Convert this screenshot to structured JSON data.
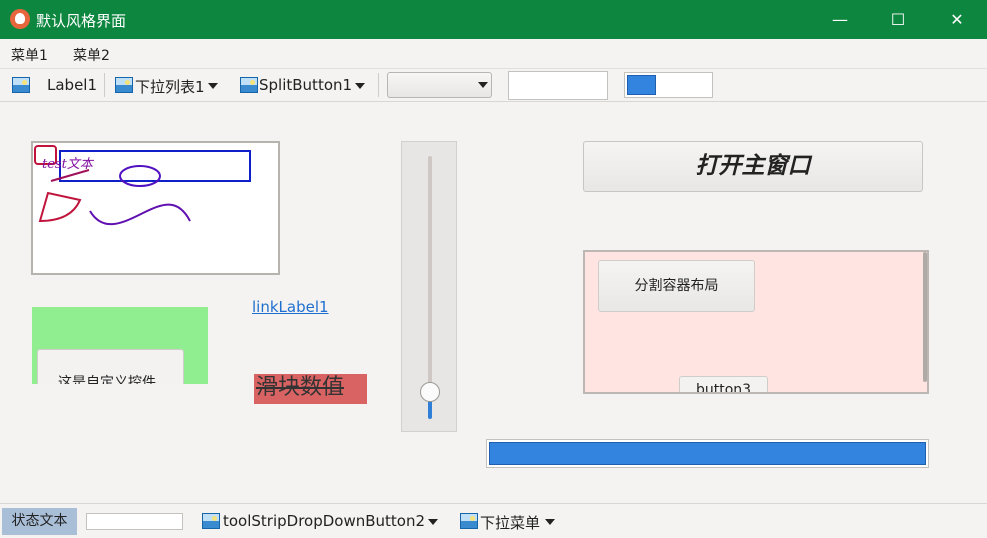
{
  "window": {
    "title": "默认风格界面",
    "controls": {
      "minimize": "—",
      "maximize": "☐",
      "close": "✕"
    }
  },
  "menu": {
    "items": [
      "菜单1",
      "菜单2"
    ]
  },
  "toolbar": {
    "label1": "Label1",
    "dropdown1": "下拉列表1",
    "split_button1": "SplitButton1",
    "combo_value": "",
    "textbox_value": "",
    "progress_fraction": 0.35
  },
  "canvas": {
    "text": "test文本",
    "colors": {
      "red": "#c0143c",
      "blue": "#1020c8",
      "purple": "#8010a0"
    }
  },
  "custom_control": {
    "label": "这是自定义控件",
    "background": "#90ee90"
  },
  "link_label": "linkLabel1",
  "slider": {
    "value_text": "滑块数值",
    "position_fraction": 0.07
  },
  "open_main_button": "打开主窗口",
  "split_container": {
    "button_label": "分割容器布局",
    "button3_label": "button3",
    "background": "#ffe4e1"
  },
  "big_progress": {
    "fraction": 1.0
  },
  "status_bar": {
    "status_text": "状态文本",
    "progress_fraction": 0.0,
    "dropdown2": "toolStripDropDownButton2",
    "dropdown_menu": "下拉菜单"
  },
  "accent_color": "#0d863f",
  "progress_color": "#3384de"
}
